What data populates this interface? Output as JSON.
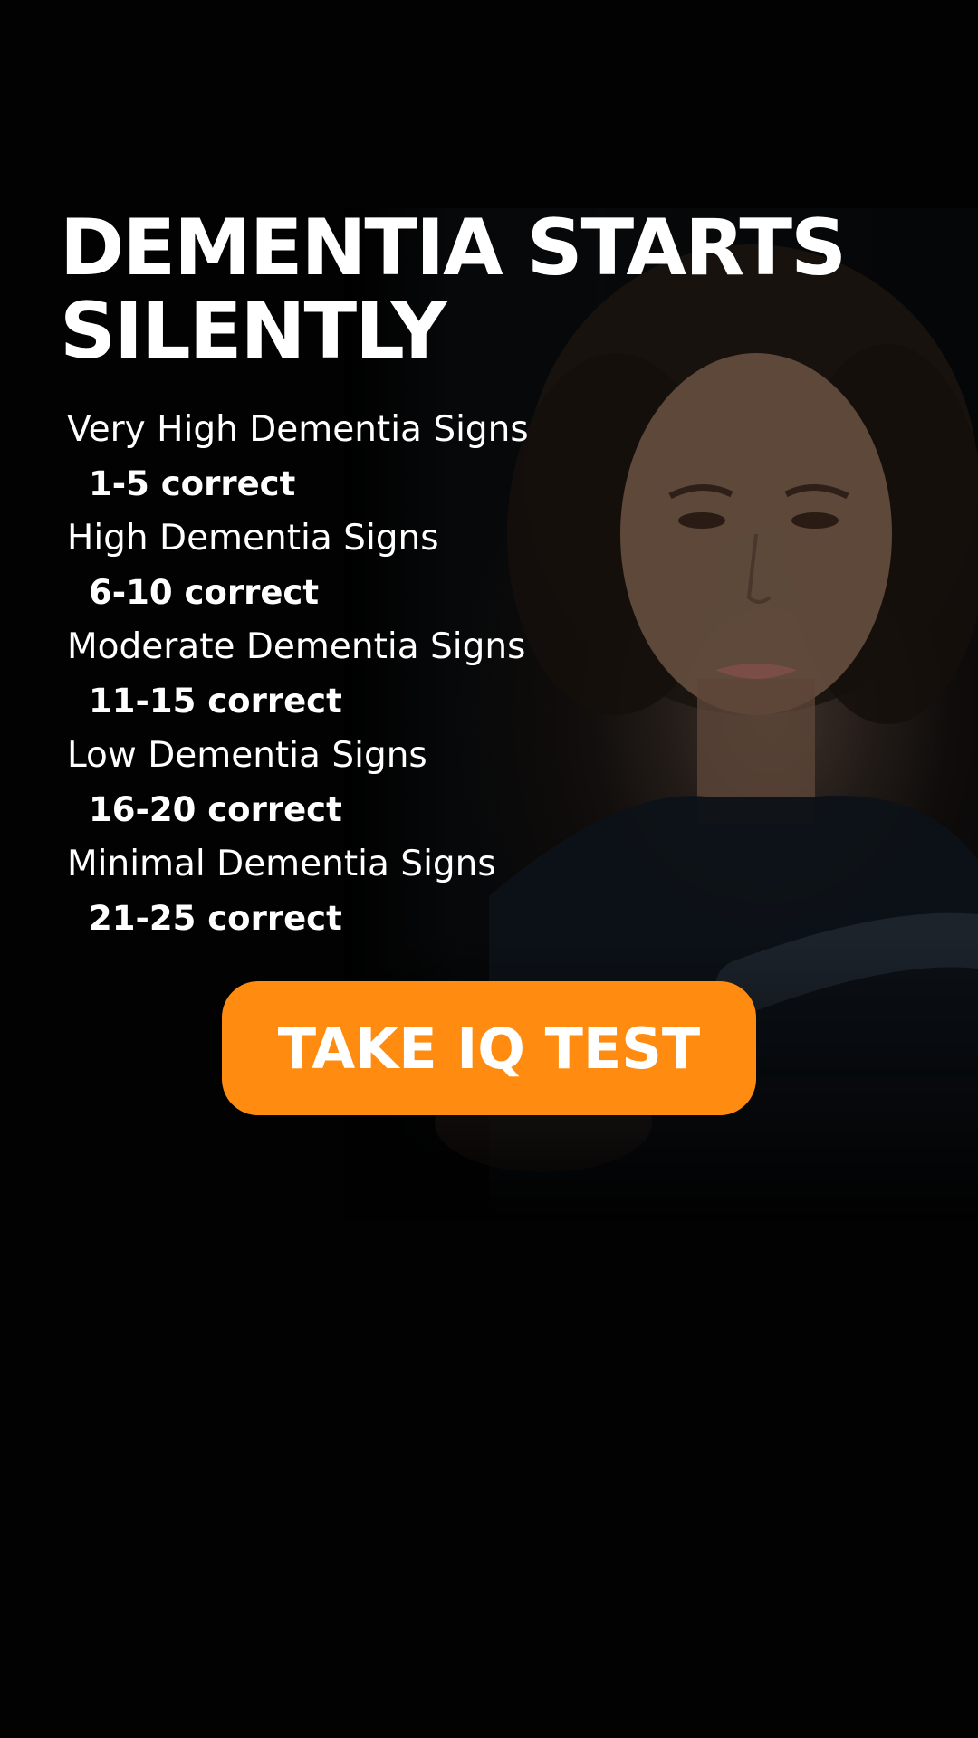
{
  "headline": {
    "line1": "DEMENTIA STARTS",
    "line2": "SILENTLY"
  },
  "scores": [
    {
      "label": "Very High Dementia Signs",
      "range": "1-5 correct"
    },
    {
      "label": "High Dementia Signs",
      "range": "6-10 correct"
    },
    {
      "label": "Moderate Dementia Signs",
      "range": "11-15 correct"
    },
    {
      "label": "Low Dementia Signs",
      "range": "16-20 correct"
    },
    {
      "label": "Minimal Dementia Signs",
      "range": "21-25 correct"
    }
  ],
  "cta": {
    "label": "TAKE IQ TEST"
  },
  "colors": {
    "background": "#000000",
    "text": "#ffffff",
    "accent": "#ff8c10"
  }
}
